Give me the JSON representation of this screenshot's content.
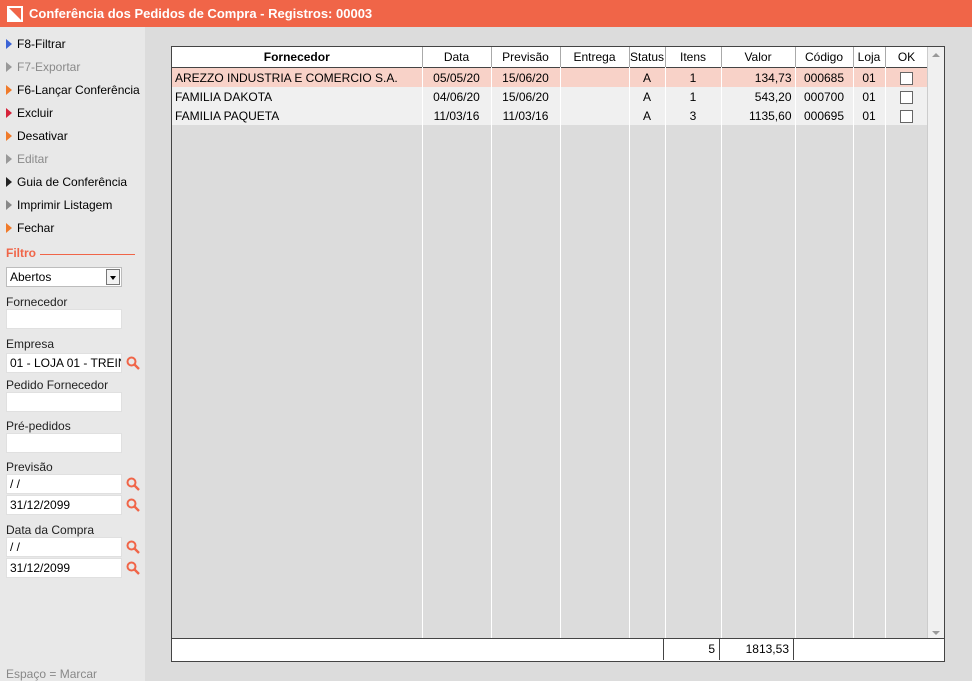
{
  "window": {
    "title": "Conferência dos Pedidos de Compra - Registros: 00003",
    "accent": "#f06548"
  },
  "menu": [
    {
      "label": "F8-Filtrar",
      "arrow": "#3b63d6",
      "enabled": true
    },
    {
      "label": "F7-Exportar",
      "arrow": "#999999",
      "enabled": false
    },
    {
      "label": "F6-Lançar Conferência",
      "arrow": "#f07a2a",
      "enabled": true
    },
    {
      "label": "Excluir",
      "arrow": "#d6223a",
      "enabled": true
    },
    {
      "label": "Desativar",
      "arrow": "#f07a2a",
      "enabled": true
    },
    {
      "label": "Editar",
      "arrow": "#999999",
      "enabled": false
    },
    {
      "label": "Guia de Conferência",
      "arrow": "#222222",
      "enabled": true
    },
    {
      "label": "Imprimir Listagem",
      "arrow": "#888888",
      "enabled": true
    },
    {
      "label": "Fechar",
      "arrow": "#f07a2a",
      "enabled": true
    }
  ],
  "filter": {
    "title": "Filtro",
    "status_select": "Abertos",
    "fornecedor_label": "Fornecedor",
    "fornecedor_value": "",
    "empresa_label": "Empresa",
    "empresa_value": "01 - LOJA 01 - TREIN",
    "pedido_fornecedor_label": "Pedido Fornecedor",
    "pedido_fornecedor_value": "",
    "pre_pedidos_label": "Pré-pedidos",
    "pre_pedidos_value": "",
    "previsao_label": "Previsão",
    "previsao_from": " /  /",
    "previsao_to": "31/12/2099",
    "data_compra_label": "Data da Compra",
    "data_compra_from": " /  /",
    "data_compra_to": "31/12/2099"
  },
  "footer_hint": "Espaço = Marcar",
  "grid": {
    "columns": [
      "Fornecedor",
      "Data",
      "Previsão",
      "Entrega",
      "Status",
      "Itens",
      "Valor",
      "Código",
      "Loja",
      "OK"
    ],
    "rows": [
      {
        "fornecedor": "AREZZO INDUSTRIA E COMERCIO S.A.",
        "data": "05/05/20",
        "previsao": "15/06/20",
        "entrega": "",
        "status": "A",
        "itens": "1",
        "valor": "134,73",
        "codigo": "000685",
        "loja": "01",
        "ok": false
      },
      {
        "fornecedor": "FAMILIA DAKOTA",
        "data": "04/06/20",
        "previsao": "15/06/20",
        "entrega": "",
        "status": "A",
        "itens": "1",
        "valor": "543,20",
        "codigo": "000700",
        "loja": "01",
        "ok": false
      },
      {
        "fornecedor": "FAMILIA PAQUETA",
        "data": "11/03/16",
        "previsao": "11/03/16",
        "entrega": "",
        "status": "A",
        "itens": "3",
        "valor": "1135,60",
        "codigo": "000695",
        "loja": "01",
        "ok": false
      }
    ],
    "totals": {
      "itens": "5",
      "valor": "1813,53"
    }
  }
}
